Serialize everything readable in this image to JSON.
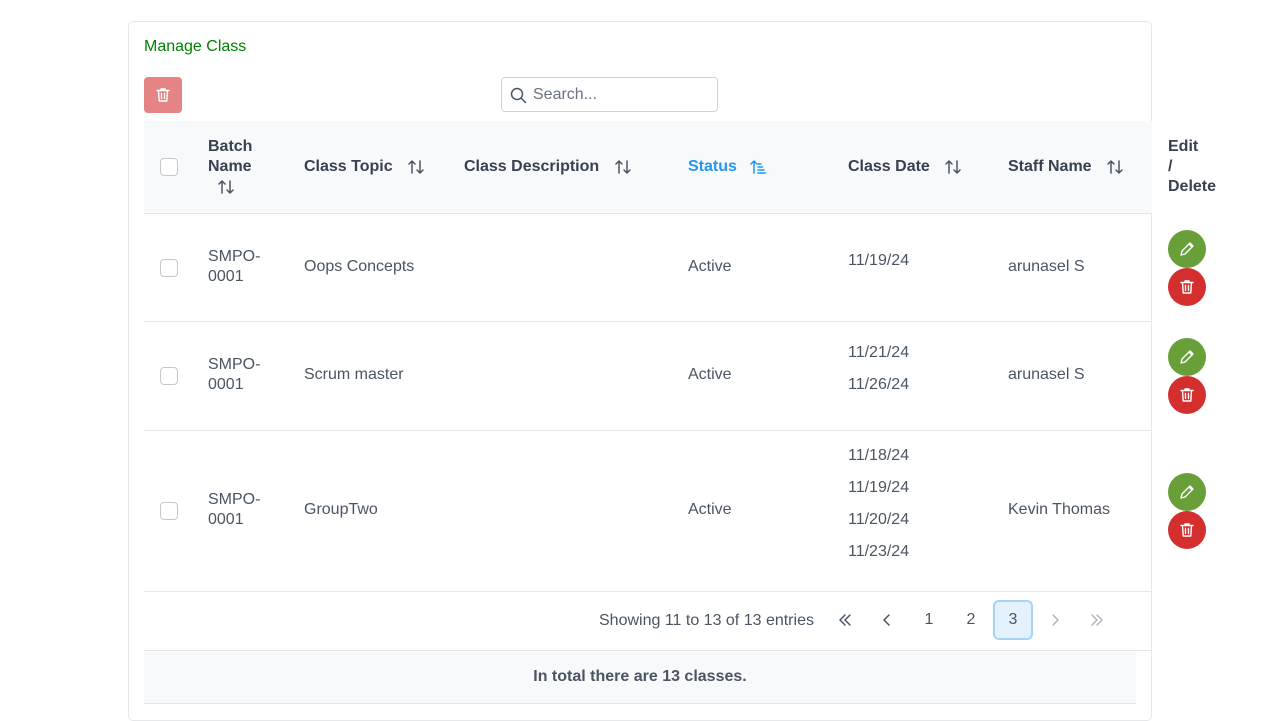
{
  "page": {
    "title": "Manage Class"
  },
  "search": {
    "placeholder": "Search..."
  },
  "table": {
    "headers": {
      "batch_line1": "Batch",
      "batch_line2": "Name",
      "class_topic": "Class Topic",
      "class_description": "Class Description",
      "status": "Status",
      "class_date": "Class Date",
      "staff_name": "Staff Name",
      "edit_line1": "Edit",
      "edit_line2": "/",
      "edit_line3": "Delete"
    },
    "rows": [
      {
        "batch_line1": "SMPO-",
        "batch_line2": "0001",
        "topic": "Oops Concepts",
        "description": "",
        "status": "Active",
        "dates": [
          "11/19/24"
        ],
        "staff": "arunasel S"
      },
      {
        "batch_line1": "SMPO-",
        "batch_line2": "0001",
        "topic": "Scrum master",
        "description": "",
        "status": "Active",
        "dates": [
          "11/21/24",
          "11/26/24"
        ],
        "staff": "arunasel S"
      },
      {
        "batch_line1": "SMPO-",
        "batch_line2": "0001",
        "topic": "GroupTwo",
        "description": "",
        "status": "Active",
        "dates": [
          "11/18/24",
          "11/19/24",
          "11/20/24",
          "11/23/24"
        ],
        "staff": "Kevin Thomas"
      }
    ]
  },
  "paginator": {
    "report": "Showing 11 to 13 of 13 entries",
    "pages": [
      "1",
      "2",
      "3"
    ],
    "current_page": "3",
    "first_icon": "chevrons-left-icon",
    "prev_icon": "chevron-left-icon",
    "next_icon": "chevron-right-icon",
    "last_icon": "chevrons-right-icon"
  },
  "footer": {
    "text": "In total there are 13 classes."
  },
  "colors": {
    "title": "#008000",
    "active_sort": "#2196f3",
    "edit": "#689f38",
    "delete": "#d32f2f",
    "bulk_delete": "#e58484"
  }
}
